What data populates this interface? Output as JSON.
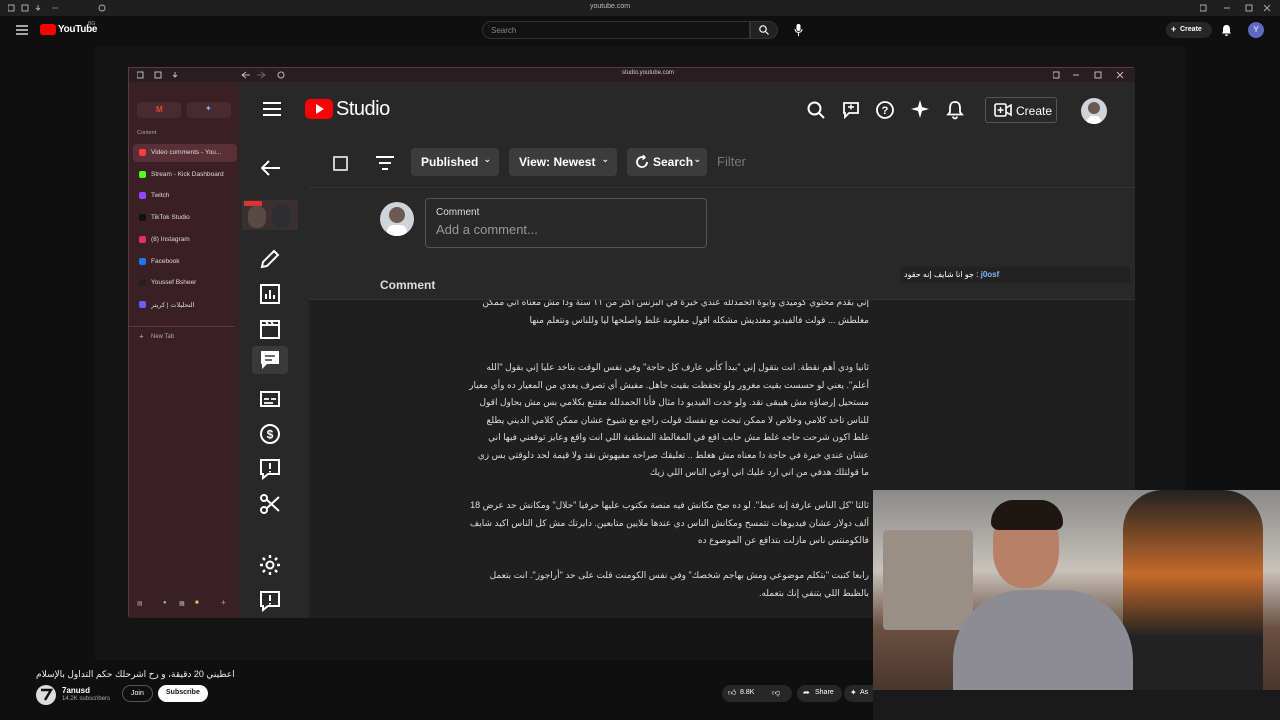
{
  "outer_browser": {
    "url": "youtube.com"
  },
  "youtube": {
    "logo_text": "YouTube",
    "region_badge": "BG",
    "search_placeholder": "Search",
    "create_label": "Create",
    "avatar_letter": "Y"
  },
  "inner_browser": {
    "url": "studio.youtube.com",
    "sidebar": {
      "section_label": "Content",
      "tabs": [
        {
          "label": "Video comments - You...",
          "color": "#ff3b3b",
          "active": true
        },
        {
          "label": "Stream - Kick Dashboard",
          "color": "#53fc18",
          "active": false
        },
        {
          "label": "Twitch",
          "color": "#9146ff",
          "active": false
        },
        {
          "label": "TikTok Studio",
          "color": "#111111",
          "active": false
        },
        {
          "label": "(8) Instagram",
          "color": "#e1306c",
          "active": false
        },
        {
          "label": "Facebook",
          "color": "#1877f2",
          "active": false
        },
        {
          "label": "Youssef Bsheer",
          "color": "#222222",
          "active": false
        },
        {
          "label": "التحليلات | كريتر",
          "color": "#6b5bff",
          "active": false
        }
      ],
      "new_tab_label": "New Tab"
    }
  },
  "studio": {
    "title": "Studio",
    "create_label": "Create",
    "filters": {
      "published": "Published",
      "view": "View: Newest",
      "search": "Search",
      "filter_placeholder": "Filter"
    },
    "compose": {
      "label": "Comment",
      "placeholder": "Add a comment..."
    },
    "comment_column_header": "Comment",
    "comment_paragraphs": [
      "إني بقدم محتوي كوميدي وايوة الحمدلله عندي خبرة في البزنس اكتر من ١١ سنة ودا مش معناه اني ممكن مغلطش ... قولت فالفيديو معنديش مشكله اقول معلومة غلط واصلحها ليا وللناس ونتعلم منها",
      "ثانيا ودي أهم نقطة. انت بتقول إني \"ببدأ كأني عارف كل حاجة\" وفي نفس الوقت بتاخد عليا إني بقول \"الله أعلم\". يعني لو حسست بقيت مغرور ولو تحفظت بقيت جاهل. مفيش أي تصرف يعدي من المعيار ده وأي معيار مستحيل إرضاؤه مش هيبقى نقد. ولو خدت الفيديو دا مثال فأنا الحمدلله مقتنع بكلامي بس مش بحاول اقول للناس تاخد كلامي وخلاص لا ممكن تبحث مع نفسك قولت راجع مع شيوخ عشان ممكن كلامي الديني يطلع غلط اكون شرحت حاجه غلط مش حابب اقع في المغالطة المنطقية اللي انت واقع وعايز توقعني فيها اني عشان عندي خبرة في حاجة دا معناه مش هغلط .. تعليقك صراحه مفيهوش نقد ولا قيمة لحد دلوقتي بس زي ما قولتلك هدفي من اني ارد عليك اني اوعي الناس اللي زيك",
      "ثالثا \"كل الناس عارفة إنه عبط\". لو ده صح مكانش فيه منصة مكتوب عليها حرفيا \"حلال\" ومكانش حد عرض 18 ألف دولار عشان فيديوهات تتمسح ومكانش الناس دي عندها ملايين متابعين. دايرتك مش كل الناس اكيد شايف فالكومنتس ناس مازلت بتدافع عن الموضوع ده",
      "رابعا كتبت \"بتكلم موضوعي ومش بهاجم شخصك\" وفي نفس الكومنت قلت على حد \"أراجوز\". انت بتعمل بالظبط اللي بتنفي إنك بتعمله."
    ]
  },
  "chat": {
    "username": "j0osf",
    "message": "جو انا شايف إنه حقود"
  },
  "video": {
    "title": "اعطيني 20 دقيقة، و رح اشرحلك حكم التداول بالإسلام",
    "channel_name": "7anusd",
    "subscribers": "14.2K subscribers",
    "join_label": "Join",
    "subscribe_label": "Subscribe",
    "likes": "8.8K",
    "share_label": "Share",
    "ask_label": "As"
  }
}
